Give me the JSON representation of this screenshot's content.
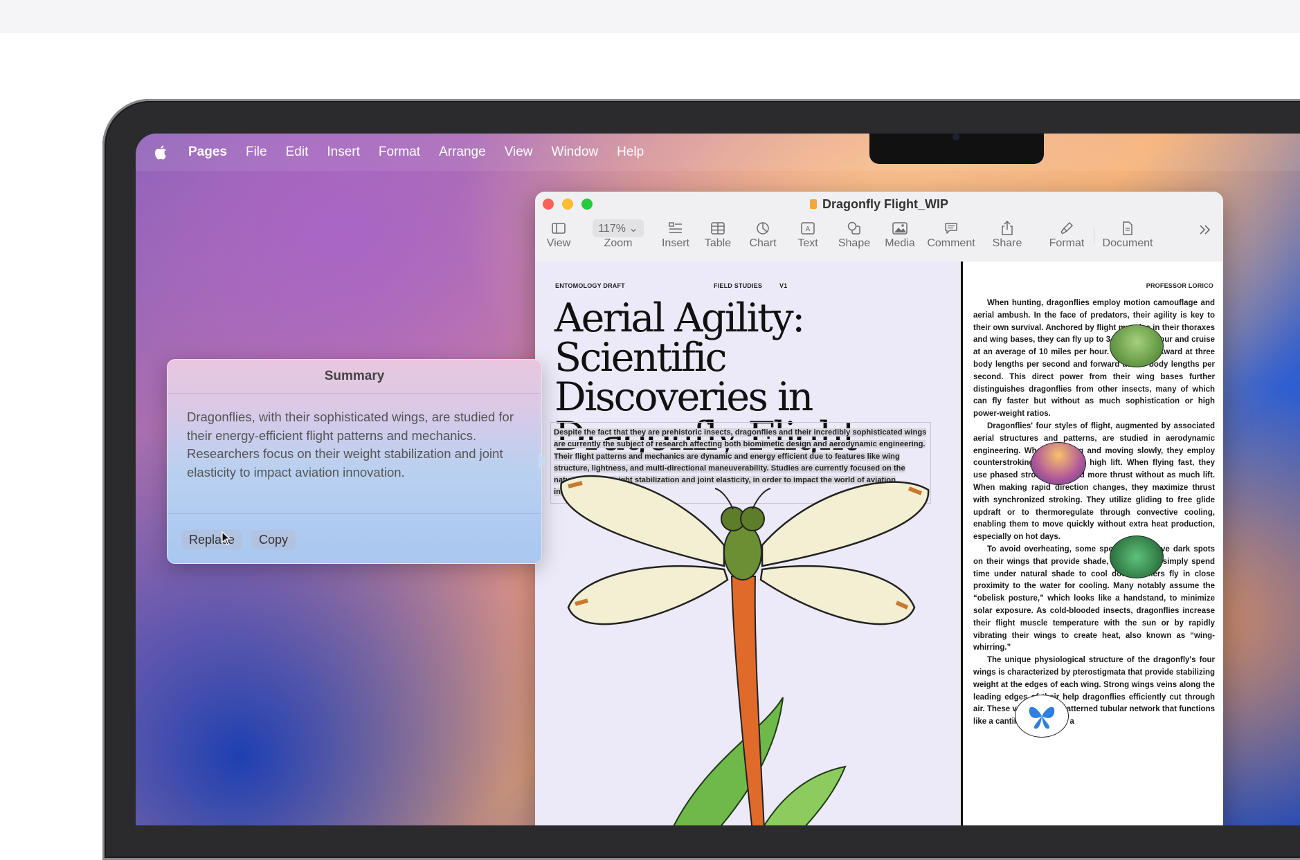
{
  "menubar": {
    "items": [
      "Pages",
      "File",
      "Edit",
      "Insert",
      "Format",
      "Arrange",
      "View",
      "Window",
      "Help"
    ]
  },
  "window": {
    "title": "Dragonfly Flight_WIP",
    "zoom_value": "117%",
    "toolbar": [
      "View",
      "Zoom",
      "Insert",
      "Table",
      "Chart",
      "Text",
      "Shape",
      "Media",
      "Comment",
      "Share",
      "Format",
      "Document"
    ]
  },
  "document": {
    "header_left": "ENTOMOLOGY DRAFT",
    "header_mid": "FIELD STUDIES",
    "header_version": "V1",
    "header_right": "PROFESSOR LORICO",
    "headline": "Aerial Agility: Scientific Discoveries in Dragonfly Flight",
    "abstract": "Despite the fact that they are prehistoric insects, dragonflies and their incredibly sophisticated wings are currently the subject of research affecting both biomimetic design and aerodynamic engineering. Their flight patterns and mechanics are dynamic and energy efficient due to features like wing structure, lightness, and multi-directional maneuverability.  Studies are currently focused on the nature of their weight stabilization and joint elasticity, in order to impact the world of aviation innovation.",
    "column_paragraphs": [
      "When hunting, dragonflies employ motion camouflage and aerial ambush. In the face of predators, their agility is key to their own survival. Anchored by flight muscles in their thoraxes and wing bases, they can fly up to 34 miles per hour and cruise at an average of 10 miles per hour. They fly backward at three body lengths per second and forward at 100 body lengths per second. This direct power from their wing bases further distinguishes dragonflies from other insects, many of which can fly faster but without as much sophistication or high power-weight ratios.",
      "Dragonflies' four styles of flight, augmented by associated aerial structures and patterns, are studied in aerodynamic engineering. When hovering and moving slowly, they employ counterstroking for efficient, high lift. When flying fast, they use phased stroking to build more thrust without as much lift. When making rapid direction changes, they maximize thrust with synchronized stroking. They utilize gliding to free glide updraft or to thermoregulate through convective cooling, enabling them to move quickly without extra heat production, especially on hot days.",
      "To avoid overheating, some species also have dark spots on their wings that provide shade, while others simply spend time under natural shade to cool down. Others fly in close proximity to the water for cooling. Many notably assume the “obelisk posture,” which looks like a handstand, to minimize solar exposure. As cold-blooded insects, dragonflies increase their flight muscle temperature with the sun or by rapidly vibrating their wings to create heat, also known as “wing-whirring.”",
      "The unique physiological structure of the dragonfly's four wings is characterized by pterostigmata that provide stabilizing weight at the edges of each wing. Strong wings veins along the leading edges of their help dragonflies efficiently cut through air. These veins form a patterned tubular network that functions like a cantilever, creating a"
    ]
  },
  "summary": {
    "title": "Summary",
    "text": "Dragonflies, with their sophisticated wings, are studied for their energy-efficient flight patterns and mechanics. Researchers focus on their weight stabilization and joint elasticity to impact aviation innovation.",
    "replace_label": "Replace",
    "copy_label": "Copy"
  },
  "colors": {
    "close": "#fe5f57",
    "minimize": "#febc2e",
    "zoom": "#28c840"
  }
}
